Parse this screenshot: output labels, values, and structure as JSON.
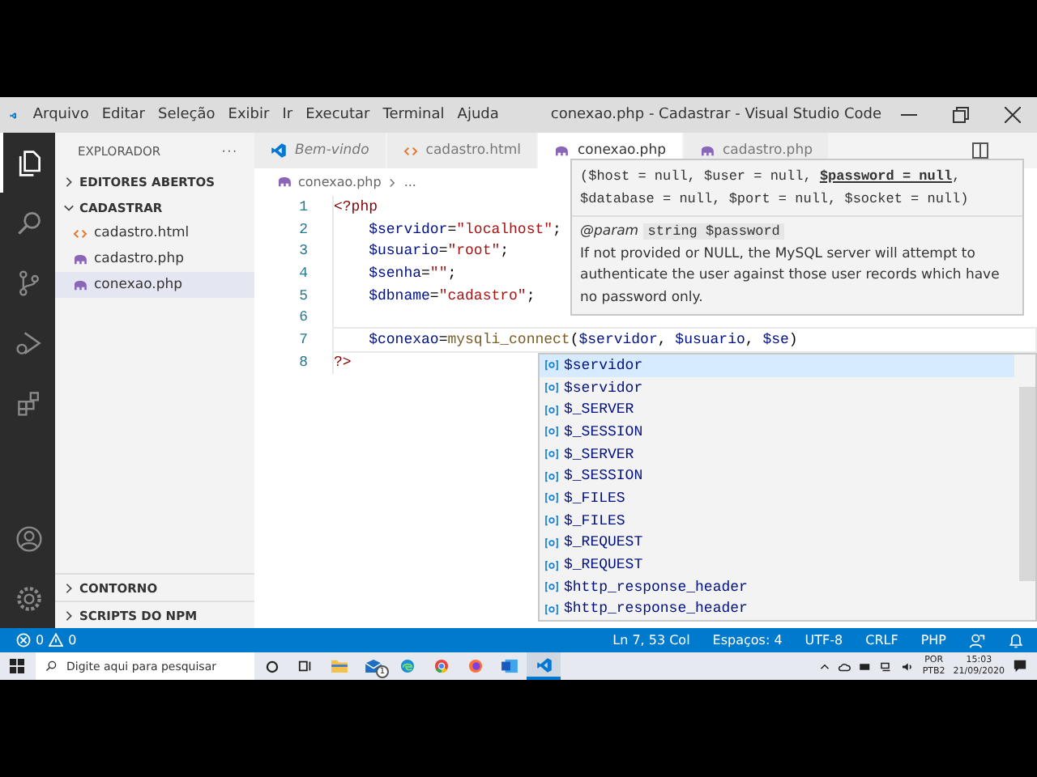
{
  "title_bar": {
    "menu": [
      "Arquivo",
      "Editar",
      "Seleção",
      "Exibir",
      "Ir",
      "Executar",
      "Terminal",
      "Ajuda"
    ],
    "title": "conexao.php - Cadastrar - Visual Studio Code"
  },
  "activity_bar": {
    "top": [
      {
        "kind": "files",
        "selected": true
      },
      {
        "kind": "search",
        "selected": false
      },
      {
        "kind": "scm",
        "selected": false
      },
      {
        "kind": "debug",
        "selected": false
      },
      {
        "kind": "extensions",
        "selected": false
      }
    ],
    "bottom": [
      {
        "kind": "account"
      },
      {
        "kind": "settings"
      }
    ]
  },
  "sidebar": {
    "title": "EXPLORADOR",
    "more": "···",
    "sections": [
      {
        "label": "EDITORES ABERTOS",
        "expanded": false
      },
      {
        "label": "CADASTRAR",
        "expanded": true,
        "files": [
          {
            "name": "cadastro.html",
            "kind": "html",
            "selected": false
          },
          {
            "name": "cadastro.php",
            "kind": "php",
            "selected": false
          },
          {
            "name": "conexao.php",
            "kind": "php",
            "selected": true
          }
        ]
      }
    ],
    "bottom_sections": [
      {
        "label": "CONTORNO",
        "expanded": false
      },
      {
        "label": "SCRIPTS DO NPM",
        "expanded": false
      }
    ]
  },
  "tabs": [
    {
      "label": "Bem-vindo",
      "kind": "vscode",
      "selected": false
    },
    {
      "label": "cadastro.html",
      "kind": "html",
      "selected": false
    },
    {
      "label": "conexao.php",
      "kind": "php",
      "selected": true
    },
    {
      "label": "cadastro.php",
      "kind": "php",
      "selected": false
    }
  ],
  "breadcrumb": [
    "conexao.php",
    "..."
  ],
  "code": [
    {
      "number": "1",
      "tokens": [
        {
          "text": "<?php",
          "kind": "tag"
        }
      ]
    },
    {
      "number": "2",
      "tokens": [
        {
          "text": "    $servidor",
          "kind": "var"
        },
        {
          "text": "=",
          "kind": "op"
        },
        {
          "text": "\"localhost\"",
          "kind": "str"
        },
        {
          "text": ";",
          "kind": "op"
        }
      ]
    },
    {
      "number": "3",
      "tokens": [
        {
          "text": "    $usuario",
          "kind": "var"
        },
        {
          "text": "=",
          "kind": "op"
        },
        {
          "text": "\"root\"",
          "kind": "str"
        },
        {
          "text": ";",
          "kind": "op"
        }
      ]
    },
    {
      "number": "4",
      "tokens": [
        {
          "text": "    $senha",
          "kind": "var"
        },
        {
          "text": "=",
          "kind": "op"
        },
        {
          "text": "\"\"",
          "kind": "str"
        },
        {
          "text": ";",
          "kind": "op"
        }
      ]
    },
    {
      "number": "5",
      "tokens": [
        {
          "text": "    $dbname",
          "kind": "var"
        },
        {
          "text": "=",
          "kind": "op"
        },
        {
          "text": "\"cadastro\"",
          "kind": "str"
        },
        {
          "text": ";",
          "kind": "op"
        }
      ]
    },
    {
      "number": "6"
    },
    {
      "number": "7",
      "current": true,
      "tokens": [
        {
          "text": "    $conexao",
          "kind": "var"
        },
        {
          "text": "=",
          "kind": "op"
        },
        {
          "text": "mysqli_connect",
          "kind": "fn"
        },
        {
          "text": "(",
          "kind": "op"
        },
        {
          "text": "$servidor",
          "kind": "var"
        },
        {
          "text": ", ",
          "kind": "op"
        },
        {
          "text": "$usuario",
          "kind": "var"
        },
        {
          "text": ", ",
          "kind": "op"
        },
        {
          "text": "$se",
          "kind": "var"
        },
        {
          "text": ")",
          "kind": "op"
        }
      ]
    },
    {
      "number": "8",
      "tokens": [
        {
          "text": "?>",
          "kind": "tag"
        }
      ]
    }
  ],
  "hover": {
    "signature_lines": [
      [
        {
          "text": "($host = null, $user = null, ",
          "active": false
        },
        {
          "text": "$password = null",
          "active": true
        },
        {
          "text": ",",
          "active": false
        }
      ],
      [
        {
          "text": "$database = null, $port = null, $socket = null)",
          "active": false
        }
      ]
    ],
    "param_tag": "@param",
    "param_type": "string $password",
    "description": "If not provided or NULL, the MySQL server will attempt to authenticate the user against those user records which have no password only."
  },
  "suggestions": [
    {
      "label": "$servidor",
      "selected": true
    },
    {
      "label": "$servidor",
      "selected": false
    },
    {
      "label": "$_SERVER",
      "selected": false
    },
    {
      "label": "$_SESSION",
      "selected": false
    },
    {
      "label": "$_SERVER",
      "selected": false
    },
    {
      "label": "$_SESSION",
      "selected": false
    },
    {
      "label": "$_FILES",
      "selected": false
    },
    {
      "label": "$_FILES",
      "selected": false
    },
    {
      "label": "$_REQUEST",
      "selected": false
    },
    {
      "label": "$_REQUEST",
      "selected": false
    },
    {
      "label": "$http_response_header",
      "selected": false
    },
    {
      "label": "$http_response_header",
      "selected": false
    }
  ],
  "status_bar": {
    "errors": "0",
    "warnings": "0",
    "items": [
      "Ln 7, 53 Col",
      "Espaços: 4",
      "UTF-8",
      "CRLF",
      "PHP"
    ]
  },
  "taskbar": {
    "search_placeholder": "Digite aqui para pesquisar",
    "apps": [
      {
        "kind": "cortana",
        "active": false
      },
      {
        "kind": "taskview",
        "active": false
      },
      {
        "kind": "folder",
        "active": false
      },
      {
        "kind": "mail",
        "active": false,
        "badge": "1"
      },
      {
        "kind": "edge",
        "active": false
      },
      {
        "kind": "chrome",
        "active": false
      },
      {
        "kind": "firefox",
        "active": false
      },
      {
        "kind": "word",
        "active": false
      },
      {
        "kind": "vscode",
        "active": true
      }
    ],
    "language": [
      "POR",
      "PTB2"
    ],
    "time": "15:03",
    "date": "21/09/2020"
  }
}
